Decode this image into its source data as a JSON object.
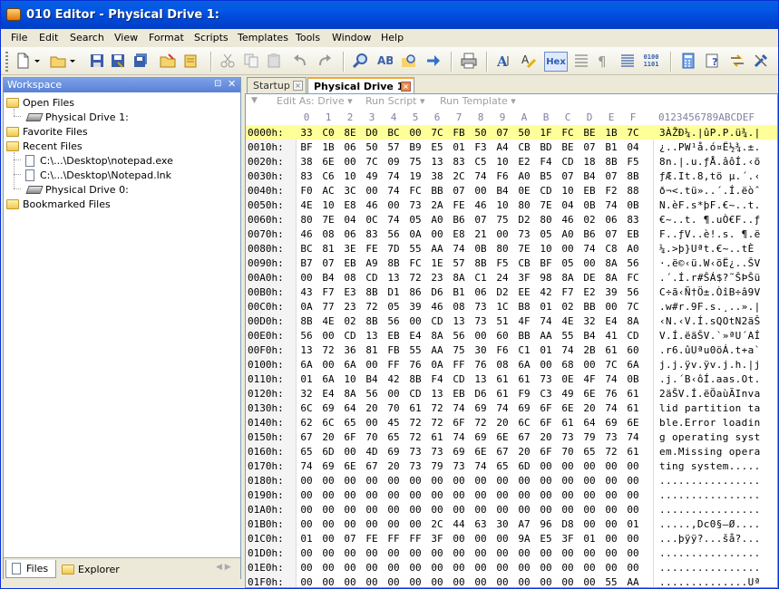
{
  "window": {
    "title": "010 Editor - Physical Drive 1:"
  },
  "menu": [
    "File",
    "Edit",
    "Search",
    "View",
    "Format",
    "Scripts",
    "Templates",
    "Tools",
    "Window",
    "Help"
  ],
  "toolbar": {
    "hex_label": "Hex",
    "binary_label_top": "0100",
    "binary_label_bottom": "1101"
  },
  "workspace": {
    "title": "Workspace",
    "pin_glyph": "⊡",
    "close_glyph": "✕",
    "open_files_label": "Open Files",
    "open_files": [
      "Physical Drive 1:"
    ],
    "favorite_files_label": "Favorite Files",
    "recent_files_label": "Recent Files",
    "recent_files": [
      "C:\\...\\Desktop\\notepad.exe",
      "C:\\...\\Desktop\\Notepad.lnk",
      "Physical Drive 0:"
    ],
    "bookmarked_files_label": "Bookmarked Files",
    "tabs": [
      "Files",
      "Explorer"
    ],
    "tab_arrows": "◀ ▶"
  },
  "doc_tabs": [
    "Startup",
    "Physical Drive 1:"
  ],
  "editor_toolbar": {
    "edit_as": "Edit As: Drive ▾",
    "run_script": "Run Script ▾",
    "run_template": "Run Template ▾"
  },
  "hex": {
    "column_headers": [
      "0",
      "1",
      "2",
      "3",
      "4",
      "5",
      "6",
      "7",
      "8",
      "9",
      "A",
      "B",
      "C",
      "D",
      "E",
      "F"
    ],
    "ascii_header": "0123456789ABCDEF",
    "selected_row": 0,
    "rows": [
      {
        "addr": "0000h:",
        "bytes": [
          "33",
          "C0",
          "8E",
          "D0",
          "BC",
          "00",
          "7C",
          "FB",
          "50",
          "07",
          "50",
          "1F",
          "FC",
          "BE",
          "1B",
          "7C"
        ],
        "ascii": "3ÀŽÐ¼.|ûP.P.ü¾.|"
      },
      {
        "addr": "0010h:",
        "bytes": [
          "BF",
          "1B",
          "06",
          "50",
          "57",
          "B9",
          "E5",
          "01",
          "F3",
          "A4",
          "CB",
          "BD",
          "BE",
          "07",
          "B1",
          "04"
        ],
        "ascii": "¿..PW¹å.ó¤Ë½¾.±."
      },
      {
        "addr": "0020h:",
        "bytes": [
          "38",
          "6E",
          "00",
          "7C",
          "09",
          "75",
          "13",
          "83",
          "C5",
          "10",
          "E2",
          "F4",
          "CD",
          "18",
          "8B",
          "F5"
        ],
        "ascii": "8n.|.u.ƒÅ.âôÍ.‹õ"
      },
      {
        "addr": "0030h:",
        "bytes": [
          "83",
          "C6",
          "10",
          "49",
          "74",
          "19",
          "38",
          "2C",
          "74",
          "F6",
          "A0",
          "B5",
          "07",
          "B4",
          "07",
          "8B"
        ],
        "ascii": "ƒÆ.It.8,tö µ.´.‹"
      },
      {
        "addr": "0040h:",
        "bytes": [
          "F0",
          "AC",
          "3C",
          "00",
          "74",
          "FC",
          "BB",
          "07",
          "00",
          "B4",
          "0E",
          "CD",
          "10",
          "EB",
          "F2",
          "88"
        ],
        "ascii": "ð¬<.tü»..´.Í.ëòˆ"
      },
      {
        "addr": "0050h:",
        "bytes": [
          "4E",
          "10",
          "E8",
          "46",
          "00",
          "73",
          "2A",
          "FE",
          "46",
          "10",
          "80",
          "7E",
          "04",
          "0B",
          "74",
          "0B"
        ],
        "ascii": "N.èF.s*þF.€~..t."
      },
      {
        "addr": "0060h:",
        "bytes": [
          "80",
          "7E",
          "04",
          "0C",
          "74",
          "05",
          "A0",
          "B6",
          "07",
          "75",
          "D2",
          "80",
          "46",
          "02",
          "06",
          "83"
        ],
        "ascii": "€~..t. ¶.uÒ€F..ƒ"
      },
      {
        "addr": "0070h:",
        "bytes": [
          "46",
          "08",
          "06",
          "83",
          "56",
          "0A",
          "00",
          "E8",
          "21",
          "00",
          "73",
          "05",
          "A0",
          "B6",
          "07",
          "EB"
        ],
        "ascii": "F..ƒV..è!.s. ¶.ë"
      },
      {
        "addr": "0080h:",
        "bytes": [
          "BC",
          "81",
          "3E",
          "FE",
          "7D",
          "55",
          "AA",
          "74",
          "0B",
          "80",
          "7E",
          "10",
          "00",
          "74",
          "C8",
          "A0"
        ],
        "ascii": "¼.>þ}Uªt.€~..tÈ "
      },
      {
        "addr": "0090h:",
        "bytes": [
          "B7",
          "07",
          "EB",
          "A9",
          "8B",
          "FC",
          "1E",
          "57",
          "8B",
          "F5",
          "CB",
          "BF",
          "05",
          "00",
          "8A",
          "56"
        ],
        "ascii": "·.ë©‹ü.W‹õË¿..ŠV"
      },
      {
        "addr": "00A0h:",
        "bytes": [
          "00",
          "B4",
          "08",
          "CD",
          "13",
          "72",
          "23",
          "8A",
          "C1",
          "24",
          "3F",
          "98",
          "8A",
          "DE",
          "8A",
          "FC"
        ],
        "ascii": ".´.Í.r#ŠÁ$?˜ŠÞŠü"
      },
      {
        "addr": "00B0h:",
        "bytes": [
          "43",
          "F7",
          "E3",
          "8B",
          "D1",
          "86",
          "D6",
          "B1",
          "06",
          "D2",
          "EE",
          "42",
          "F7",
          "E2",
          "39",
          "56"
        ],
        "ascii": "C÷ã‹Ñ†Ö±.ÒîB÷â9V"
      },
      {
        "addr": "00C0h:",
        "bytes": [
          "0A",
          "77",
          "23",
          "72",
          "05",
          "39",
          "46",
          "08",
          "73",
          "1C",
          "B8",
          "01",
          "02",
          "BB",
          "00",
          "7C"
        ],
        "ascii": ".w#r.9F.s.¸..».|"
      },
      {
        "addr": "00D0h:",
        "bytes": [
          "8B",
          "4E",
          "02",
          "8B",
          "56",
          "00",
          "CD",
          "13",
          "73",
          "51",
          "4F",
          "74",
          "4E",
          "32",
          "E4",
          "8A"
        ],
        "ascii": "‹N.‹V.Í.sQOtN2äŠ"
      },
      {
        "addr": "00E0h:",
        "bytes": [
          "56",
          "00",
          "CD",
          "13",
          "EB",
          "E4",
          "8A",
          "56",
          "00",
          "60",
          "BB",
          "AA",
          "55",
          "B4",
          "41",
          "CD"
        ],
        "ascii": "V.Í.ëäŠV.`»ªU´AÍ"
      },
      {
        "addr": "00F0h:",
        "bytes": [
          "13",
          "72",
          "36",
          "81",
          "FB",
          "55",
          "AA",
          "75",
          "30",
          "F6",
          "C1",
          "01",
          "74",
          "2B",
          "61",
          "60"
        ],
        "ascii": ".r6.ûUªu0öÁ.t+a`"
      },
      {
        "addr": "0100h:",
        "bytes": [
          "6A",
          "00",
          "6A",
          "00",
          "FF",
          "76",
          "0A",
          "FF",
          "76",
          "08",
          "6A",
          "00",
          "68",
          "00",
          "7C",
          "6A"
        ],
        "ascii": "j.j.ÿv.ÿv.j.h.|j"
      },
      {
        "addr": "0110h:",
        "bytes": [
          "01",
          "6A",
          "10",
          "B4",
          "42",
          "8B",
          "F4",
          "CD",
          "13",
          "61",
          "61",
          "73",
          "0E",
          "4F",
          "74",
          "0B"
        ],
        "ascii": ".j.´B‹ôÍ.aas.Ot."
      },
      {
        "addr": "0120h:",
        "bytes": [
          "32",
          "E4",
          "8A",
          "56",
          "00",
          "CD",
          "13",
          "EB",
          "D6",
          "61",
          "F9",
          "C3",
          "49",
          "6E",
          "76",
          "61"
        ],
        "ascii": "2äŠV.Í.ëÖaùÃInva"
      },
      {
        "addr": "0130h:",
        "bytes": [
          "6C",
          "69",
          "64",
          "20",
          "70",
          "61",
          "72",
          "74",
          "69",
          "74",
          "69",
          "6F",
          "6E",
          "20",
          "74",
          "61"
        ],
        "ascii": "lid partition ta"
      },
      {
        "addr": "0140h:",
        "bytes": [
          "62",
          "6C",
          "65",
          "00",
          "45",
          "72",
          "72",
          "6F",
          "72",
          "20",
          "6C",
          "6F",
          "61",
          "64",
          "69",
          "6E"
        ],
        "ascii": "ble.Error loadin"
      },
      {
        "addr": "0150h:",
        "bytes": [
          "67",
          "20",
          "6F",
          "70",
          "65",
          "72",
          "61",
          "74",
          "69",
          "6E",
          "67",
          "20",
          "73",
          "79",
          "73",
          "74"
        ],
        "ascii": "g operating syst"
      },
      {
        "addr": "0160h:",
        "bytes": [
          "65",
          "6D",
          "00",
          "4D",
          "69",
          "73",
          "73",
          "69",
          "6E",
          "67",
          "20",
          "6F",
          "70",
          "65",
          "72",
          "61"
        ],
        "ascii": "em.Missing opera"
      },
      {
        "addr": "0170h:",
        "bytes": [
          "74",
          "69",
          "6E",
          "67",
          "20",
          "73",
          "79",
          "73",
          "74",
          "65",
          "6D",
          "00",
          "00",
          "00",
          "00",
          "00"
        ],
        "ascii": "ting system....."
      },
      {
        "addr": "0180h:",
        "bytes": [
          "00",
          "00",
          "00",
          "00",
          "00",
          "00",
          "00",
          "00",
          "00",
          "00",
          "00",
          "00",
          "00",
          "00",
          "00",
          "00"
        ],
        "ascii": "................"
      },
      {
        "addr": "0190h:",
        "bytes": [
          "00",
          "00",
          "00",
          "00",
          "00",
          "00",
          "00",
          "00",
          "00",
          "00",
          "00",
          "00",
          "00",
          "00",
          "00",
          "00"
        ],
        "ascii": "................"
      },
      {
        "addr": "01A0h:",
        "bytes": [
          "00",
          "00",
          "00",
          "00",
          "00",
          "00",
          "00",
          "00",
          "00",
          "00",
          "00",
          "00",
          "00",
          "00",
          "00",
          "00"
        ],
        "ascii": "................"
      },
      {
        "addr": "01B0h:",
        "bytes": [
          "00",
          "00",
          "00",
          "00",
          "00",
          "00",
          "2C",
          "44",
          "63",
          "30",
          "A7",
          "96",
          "D8",
          "00",
          "00",
          "01"
        ],
        "ascii": ".....,Dc0§–Ø...."
      },
      {
        "addr": "01C0h:",
        "bytes": [
          "01",
          "00",
          "07",
          "FE",
          "FF",
          "FF",
          "3F",
          "00",
          "00",
          "00",
          "9A",
          "E5",
          "3F",
          "01",
          "00",
          "00"
        ],
        "ascii": "...þÿÿ?...šå?..."
      },
      {
        "addr": "01D0h:",
        "bytes": [
          "00",
          "00",
          "00",
          "00",
          "00",
          "00",
          "00",
          "00",
          "00",
          "00",
          "00",
          "00",
          "00",
          "00",
          "00",
          "00"
        ],
        "ascii": "................"
      },
      {
        "addr": "01E0h:",
        "bytes": [
          "00",
          "00",
          "00",
          "00",
          "00",
          "00",
          "00",
          "00",
          "00",
          "00",
          "00",
          "00",
          "00",
          "00",
          "00",
          "00"
        ],
        "ascii": "................"
      },
      {
        "addr": "01F0h:",
        "bytes": [
          "00",
          "00",
          "00",
          "00",
          "00",
          "00",
          "00",
          "00",
          "00",
          "00",
          "00",
          "00",
          "00",
          "00",
          "55",
          "AA"
        ],
        "ascii": "..............Uª"
      }
    ]
  }
}
